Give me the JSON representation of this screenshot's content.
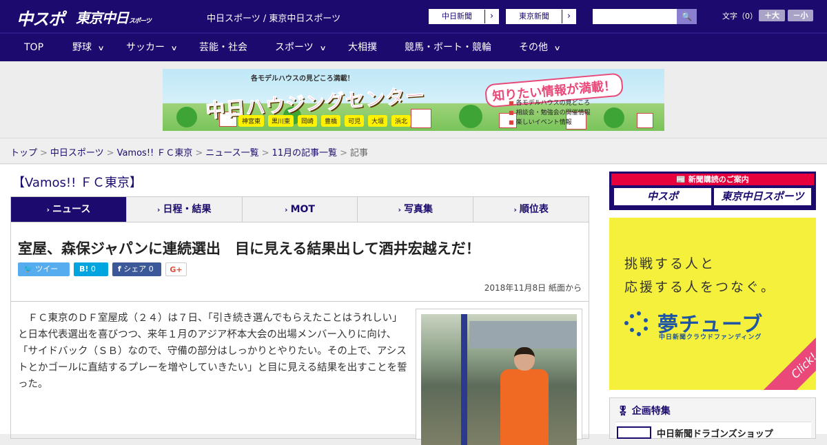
{
  "header": {
    "logo_chuspo": "中スポ",
    "logo_tokyo": "東京中日",
    "logo_tokyo_sub": "スポーツ",
    "site_title": "中日スポーツ / 東京中日スポーツ",
    "btn_chunichi": "中日新聞",
    "btn_tokyo": "東京新聞",
    "search_placeholder": "",
    "font_size_label": "文字（0）",
    "font_large": "＋大",
    "font_small": "－小"
  },
  "nav": [
    {
      "label": "TOP",
      "has_menu": false
    },
    {
      "label": "野球",
      "has_menu": true
    },
    {
      "label": "サッカー",
      "has_menu": true
    },
    {
      "label": "芸能・社会",
      "has_menu": false
    },
    {
      "label": "スポーツ",
      "has_menu": true
    },
    {
      "label": "大相撲",
      "has_menu": false
    },
    {
      "label": "競馬・ボート・競輪",
      "has_menu": false
    },
    {
      "label": "その他",
      "has_menu": true
    }
  ],
  "banner": {
    "small": "各モデルハウスの見どころ満載！",
    "main": "中日ハウジングセンター",
    "tags": [
      "神宮東",
      "黒川東",
      "岡崎",
      "豊橋",
      "可児",
      "大垣",
      "浜北"
    ],
    "right_head": "知りたい情報が満載！",
    "list": [
      "各モデルハウスの見どころ",
      "相談会・勉強会の開催情報",
      "楽しいイベント情報"
    ]
  },
  "breadcrumb": {
    "links": [
      "トップ",
      "中日スポーツ",
      "Vamos!! ＦＣ東京",
      "ニュース一覧",
      "11月の記事一覧"
    ],
    "current": "記事"
  },
  "section_title": "【Vamos!! ＦＣ東京】",
  "tabs": [
    {
      "label": "ニュース",
      "active": true
    },
    {
      "label": "日程・結果",
      "active": false
    },
    {
      "label": "MOT",
      "active": false
    },
    {
      "label": "写真集",
      "active": false
    },
    {
      "label": "順位表",
      "active": false
    }
  ],
  "article": {
    "headline": "室屋、森保ジャパンに連続選出　目に見える結果出して酒井宏越えだ！",
    "share": {
      "tweet": "ツイート",
      "hatena_count": "0",
      "facebook": "シェア 0",
      "gplus": "G+"
    },
    "date": "2018年11月8日 紙面から",
    "body": "　ＦＣ東京のＤＦ室屋成（２４）は７日、「引き続き選んでもらえたことはうれしい」と日本代表選出を喜びつつ、来年１月のアジア杯本大会の出場メンバー入りに向け、「サイドバック（ＳＢ）なので、守備の部分はしっかりとやりたい。その上で、アシストとかゴールに直結するプレーを増やしていきたい」と目に見える結果を出すことを誓った。"
  },
  "sidebar": {
    "subscribe_head": "新聞購読のご案内",
    "subscribe_logos": [
      "中スポ",
      "東京中日スポーツ"
    ],
    "ad_line1": "挑戦する人と",
    "ad_line2": "応援する人をつなぐ。",
    "ad_logo": "夢チューブ",
    "ad_sub": "中日新聞クラウドファンディング",
    "ad_click": "Click!",
    "special_head": "企画特集",
    "special_item": "中日新聞ドラゴンズショップ"
  },
  "colors": {
    "brand": "#1c0a6e",
    "accent": "#e6003c",
    "ad_yellow": "#f4f03c"
  }
}
